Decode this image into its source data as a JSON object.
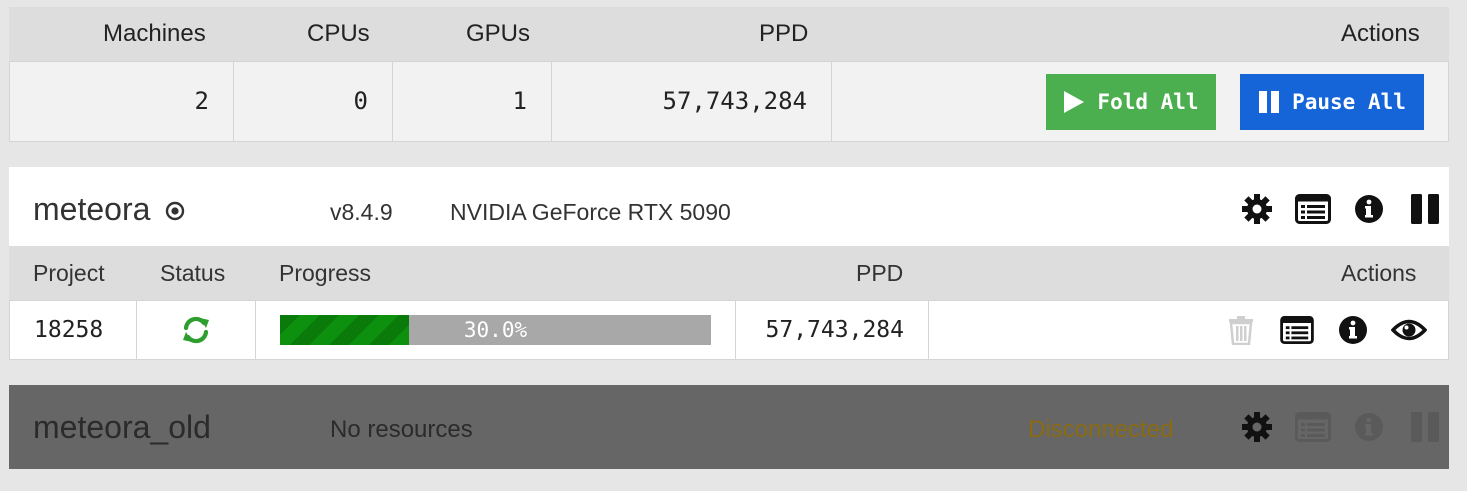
{
  "summary": {
    "headers": {
      "machines": "Machines",
      "cpus": "CPUs",
      "gpus": "GPUs",
      "ppd": "PPD",
      "actions": "Actions"
    },
    "values": {
      "machines": "2",
      "cpus": "0",
      "gpus": "1",
      "ppd": "57,743,284"
    },
    "fold_all_label": "Fold All",
    "pause_all_label": "Pause All"
  },
  "machines": [
    {
      "name": "meteora",
      "version": "v8.4.9",
      "gpu": "NVIDIA GeForce RTX 5090",
      "unit_headers": {
        "project": "Project",
        "status": "Status",
        "progress": "Progress",
        "ppd": "PPD",
        "actions": "Actions"
      },
      "units": [
        {
          "project": "18258",
          "status_icon": "sync-icon",
          "progress_pct": 30.0,
          "progress_label": "30.0%",
          "ppd": "57,743,284"
        }
      ]
    },
    {
      "name": "meteora_old",
      "resources": "No resources",
      "status": "Disconnected"
    }
  ],
  "colors": {
    "fold_green": "#4bae4f",
    "pause_blue": "#1565d8",
    "progress_green": "#0a7a0a",
    "status_green": "#2e9e2e",
    "disconnected": "#8a6a12"
  }
}
